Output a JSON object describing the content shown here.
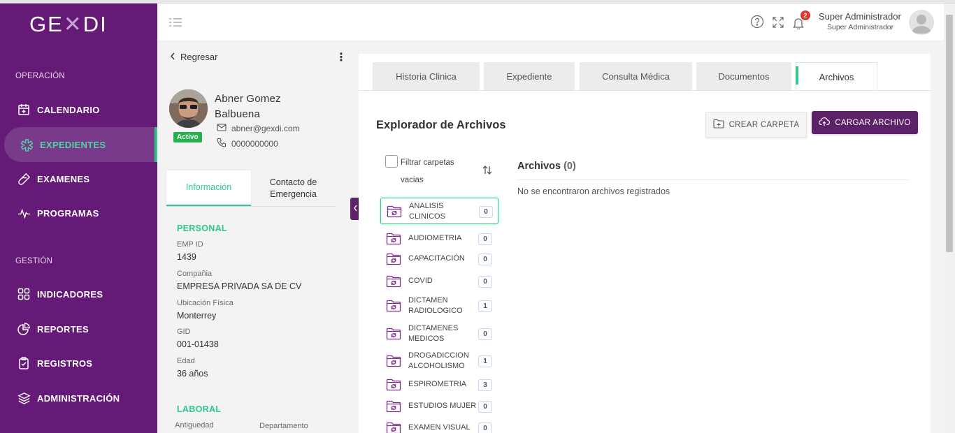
{
  "app": {
    "logo_text_left": "GE",
    "logo_text_right": "DI"
  },
  "sidebar": {
    "section_operacion": "OPERACIÓN",
    "section_gestion": "GESTIÓN",
    "items": [
      {
        "label": "CALENDARIO",
        "icon": "calendar-icon"
      },
      {
        "label": "EXPEDIENTES",
        "icon": "medical-star-icon",
        "active": true
      },
      {
        "label": "EXAMENES",
        "icon": "flask-icon"
      },
      {
        "label": "PROGRAMAS",
        "icon": "pulse-icon"
      },
      {
        "label": "INDICADORES",
        "icon": "grid-icon"
      },
      {
        "label": "REPORTES",
        "icon": "pie-chart-icon"
      },
      {
        "label": "REGISTROS",
        "icon": "clipboard-icon"
      },
      {
        "label": "ADMINISTRACIÓN",
        "icon": "layers-icon"
      }
    ]
  },
  "header": {
    "notification_count": "2",
    "user_name": "Super Administrador",
    "user_role": "Super Administrador"
  },
  "patient": {
    "back_label": "Regresar",
    "name": "Abner Gomez Balbuena",
    "status": "Activo",
    "email": "abner@gexdi.com",
    "phone": "0000000000",
    "tabs": [
      "Información",
      "Contacto de Emergencia"
    ],
    "personal_title": "PERSONAL",
    "fields": [
      {
        "label": "EMP ID",
        "value": "1439"
      },
      {
        "label": "Compañia",
        "value": "EMPRESA PRIVADA SA DE CV"
      },
      {
        "label": "Ubicación Física",
        "value": "Monterrey"
      },
      {
        "label": "GID",
        "value": "001-01438"
      },
      {
        "label": "Edad",
        "value": "36 años"
      }
    ],
    "laboral_title": "LABORAL",
    "laboral_labels": [
      "Antiguedad",
      "Departamento"
    ]
  },
  "main": {
    "tabs": [
      "Historia Clinica",
      "Expediente",
      "Consulta Médica",
      "Documentos",
      "Archivos"
    ],
    "active_tab": "Archivos",
    "explorer_title": "Explorador de Archivos",
    "crear_carpeta": "CREAR CARPETA",
    "cargar_archivo": "CARGAR ARCHIVO",
    "filter_label": "Filtrar carpetas vacias",
    "folders": [
      {
        "name": "ANALISIS CLINICOS",
        "count": "0",
        "selected": true
      },
      {
        "name": "AUDIOMETRIA",
        "count": "0"
      },
      {
        "name": "CAPACITACIÓN",
        "count": "0"
      },
      {
        "name": "COVID",
        "count": "0"
      },
      {
        "name": "DICTAMEN RADIOLOGICO",
        "count": "1"
      },
      {
        "name": "DICTAMENES MEDICOS",
        "count": "0"
      },
      {
        "name": "DROGADICCION ALCOHOLISMO",
        "count": "1"
      },
      {
        "name": "ESPIROMETRIA",
        "count": "3"
      },
      {
        "name": "ESTUDIOS MUJER",
        "count": "0"
      },
      {
        "name": "EXAMEN VISUAL",
        "count": "0"
      }
    ],
    "archivos_title": "Archivos",
    "archivos_count": "(0)",
    "empty_message": "No se encontraron archivos registrados"
  },
  "colors": {
    "sidebar": "#651a78",
    "accent": "#2ec98b",
    "primary_button": "#5c2168",
    "badge": "#e0342c"
  }
}
